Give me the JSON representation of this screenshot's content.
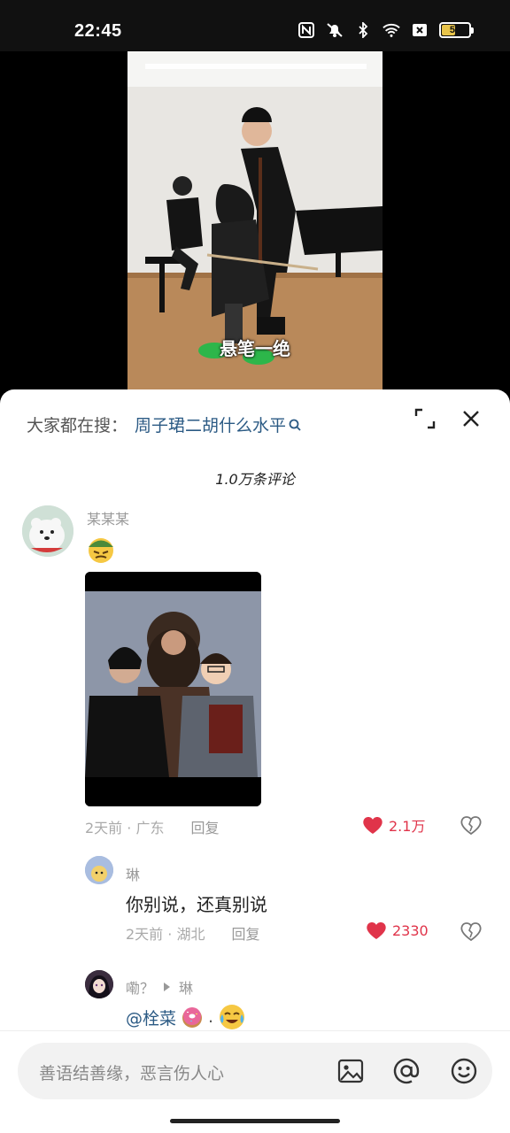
{
  "status": {
    "time": "22:45",
    "battery": "50",
    "battery_level": 0.5
  },
  "video": {
    "caption": "悬笔一绝"
  },
  "sheet": {
    "search_label": "大家都在搜：",
    "search_query": "周子珺二胡什么水平",
    "comment_count": "1.0万条评论"
  },
  "comments": [
    {
      "user": "某某某",
      "time": "2天前",
      "location": "广东",
      "reply": "回复",
      "likes": "2.1万"
    }
  ],
  "replies": [
    {
      "user": "琳",
      "text": "你别说，还真别说",
      "time": "2天前",
      "location": "湖北",
      "reply": "回复",
      "likes": "2330"
    },
    {
      "user": "嘞？",
      "to": "琳",
      "mention": "@栓菜"
    }
  ],
  "input": {
    "placeholder": "善语结善缘，恶言伤人心"
  },
  "colors": {
    "like": "#e0344a",
    "link": "#2b5a84",
    "battery": "#e8c44a"
  }
}
